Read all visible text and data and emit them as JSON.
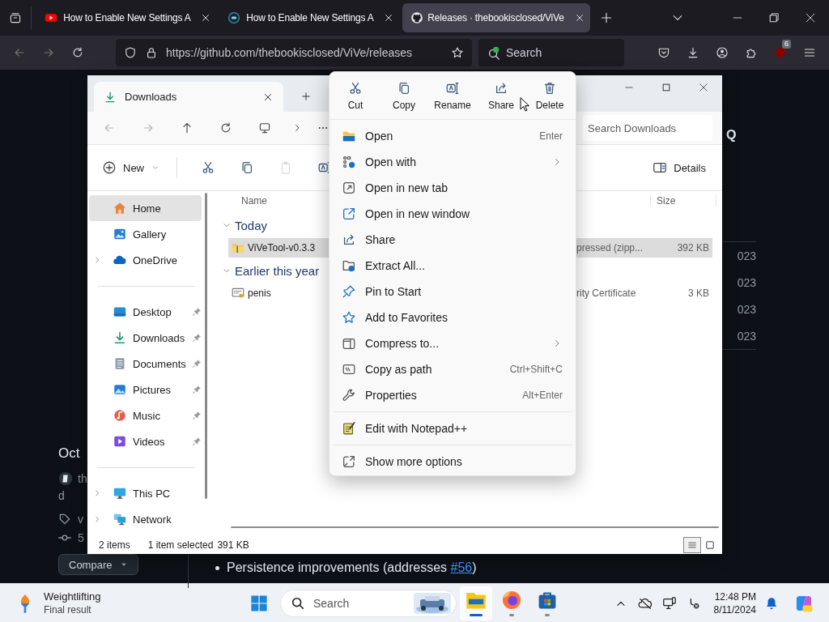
{
  "browser": {
    "tabs": [
      {
        "title": "How to Enable New Settings A",
        "kind": "youtube",
        "selected": false
      },
      {
        "title": "How to Enable New Settings A",
        "kind": "site",
        "selected": false
      },
      {
        "title": "Releases · thebookisclosed/ViVe",
        "kind": "github",
        "selected": true
      }
    ],
    "address": "https://github.com/thebookisclosed/ViVe/releases",
    "search_placeholder": "Search",
    "extension_badge": "6"
  },
  "page": {
    "letter": "Q",
    "date": "Oct",
    "author": "th",
    "author_tail": "d",
    "tag": "v",
    "commit": "5",
    "compare_button": "Compare",
    "bullet": {
      "text": "Persistence improvements (addresses ",
      "link": "#56",
      "tail": ")"
    },
    "side_dates": [
      "023",
      "023",
      "023",
      "023"
    ]
  },
  "explorer": {
    "tab_title": "Downloads",
    "search_placeholder": "Search Downloads",
    "new_button": "New",
    "tools": [
      {
        "kind": "cut",
        "disabled": false
      },
      {
        "kind": "copy",
        "disabled": false
      },
      {
        "kind": "paste",
        "disabled": true
      },
      {
        "kind": "rename",
        "disabled": false
      }
    ],
    "details_button": "Details",
    "sidebar": [
      [
        {
          "label": "Home",
          "kind": "home",
          "selected": true,
          "pinned": false,
          "expandable": false
        },
        {
          "label": "Gallery",
          "kind": "gallery",
          "selected": false,
          "pinned": false,
          "expandable": false
        },
        {
          "label": "OneDrive",
          "kind": "cloud",
          "selected": false,
          "pinned": false,
          "expandable": true
        }
      ],
      [
        {
          "label": "Desktop",
          "kind": "desktop",
          "selected": false,
          "pinned": true,
          "expandable": false
        },
        {
          "label": "Downloads",
          "kind": "download",
          "selected": false,
          "pinned": true,
          "expandable": false
        },
        {
          "label": "Documents",
          "kind": "document",
          "selected": false,
          "pinned": true,
          "expandable": false
        },
        {
          "label": "Pictures",
          "kind": "picture",
          "selected": false,
          "pinned": true,
          "expandable": false
        },
        {
          "label": "Music",
          "kind": "music",
          "selected": false,
          "pinned": true,
          "expandable": false
        },
        {
          "label": "Videos",
          "kind": "video",
          "selected": false,
          "pinned": true,
          "expandable": false
        }
      ],
      [
        {
          "label": "This PC",
          "kind": "pc",
          "selected": false,
          "pinned": false,
          "expandable": true
        },
        {
          "label": "Network",
          "kind": "network",
          "selected": false,
          "pinned": false,
          "expandable": true
        }
      ]
    ],
    "columns": {
      "name": "Name",
      "size": "Size"
    },
    "groups": [
      {
        "title": "Today",
        "expanded": true,
        "files": [
          {
            "name": "ViVeTool-v0.3.3",
            "kind": "zip",
            "type": "pressed (zipp...",
            "size": "392 KB",
            "selected": true
          }
        ]
      },
      {
        "title": "Earlier this year",
        "expanded": true,
        "files": [
          {
            "name": "penis",
            "kind": "certificate",
            "type": "rity Certificate",
            "size": "3 KB",
            "selected": false
          }
        ]
      }
    ],
    "status": {
      "count": "2 items",
      "selection": "1 item selected",
      "size": "391 KB"
    },
    "view_buttons": [
      {
        "kind": "details",
        "selected": true
      },
      {
        "kind": "tiles",
        "selected": false
      }
    ]
  },
  "context_menu": {
    "actions": [
      {
        "label": "Cut",
        "kind": "cut"
      },
      {
        "label": "Copy",
        "kind": "copy"
      },
      {
        "label": "Rename",
        "kind": "rename"
      },
      {
        "label": "Share",
        "kind": "share"
      },
      {
        "label": "Delete",
        "kind": "delete"
      }
    ],
    "sections": [
      [
        {
          "label": "Open",
          "kind": "open",
          "shortcut": "Enter",
          "submenu": false
        },
        {
          "label": "Open with",
          "kind": "openwith",
          "submenu": true
        },
        {
          "label": "Open in new tab",
          "kind": "newtab",
          "submenu": false
        },
        {
          "label": "Open in new window",
          "kind": "newwindow",
          "submenu": false
        },
        {
          "label": "Share",
          "kind": "share",
          "submenu": false
        },
        {
          "label": "Extract All...",
          "kind": "extract",
          "submenu": false
        },
        {
          "label": "Pin to Start",
          "kind": "pin",
          "submenu": false
        },
        {
          "label": "Add to Favorites",
          "kind": "star",
          "submenu": false
        },
        {
          "label": "Compress to...",
          "kind": "compress",
          "submenu": true
        },
        {
          "label": "Copy as path",
          "kind": "copypath",
          "shortcut": "Ctrl+Shift+C",
          "submenu": false
        },
        {
          "label": "Properties",
          "kind": "properties",
          "shortcut": "Alt+Enter",
          "submenu": false
        }
      ],
      [
        {
          "label": "Edit with Notepad++",
          "kind": "notepad",
          "submenu": false
        }
      ],
      [
        {
          "label": "Show more options",
          "kind": "moreopts",
          "submenu": false
        }
      ]
    ]
  },
  "taskbar": {
    "widget": {
      "title": "Weightlifting",
      "subtitle": "Final result"
    },
    "search_placeholder": "Search",
    "apps": [
      {
        "kind": "explorer",
        "active": true
      },
      {
        "kind": "firefox",
        "active": false
      },
      {
        "kind": "store",
        "active": false
      }
    ],
    "time": "12:48 PM",
    "date": "8/11/2024"
  }
}
